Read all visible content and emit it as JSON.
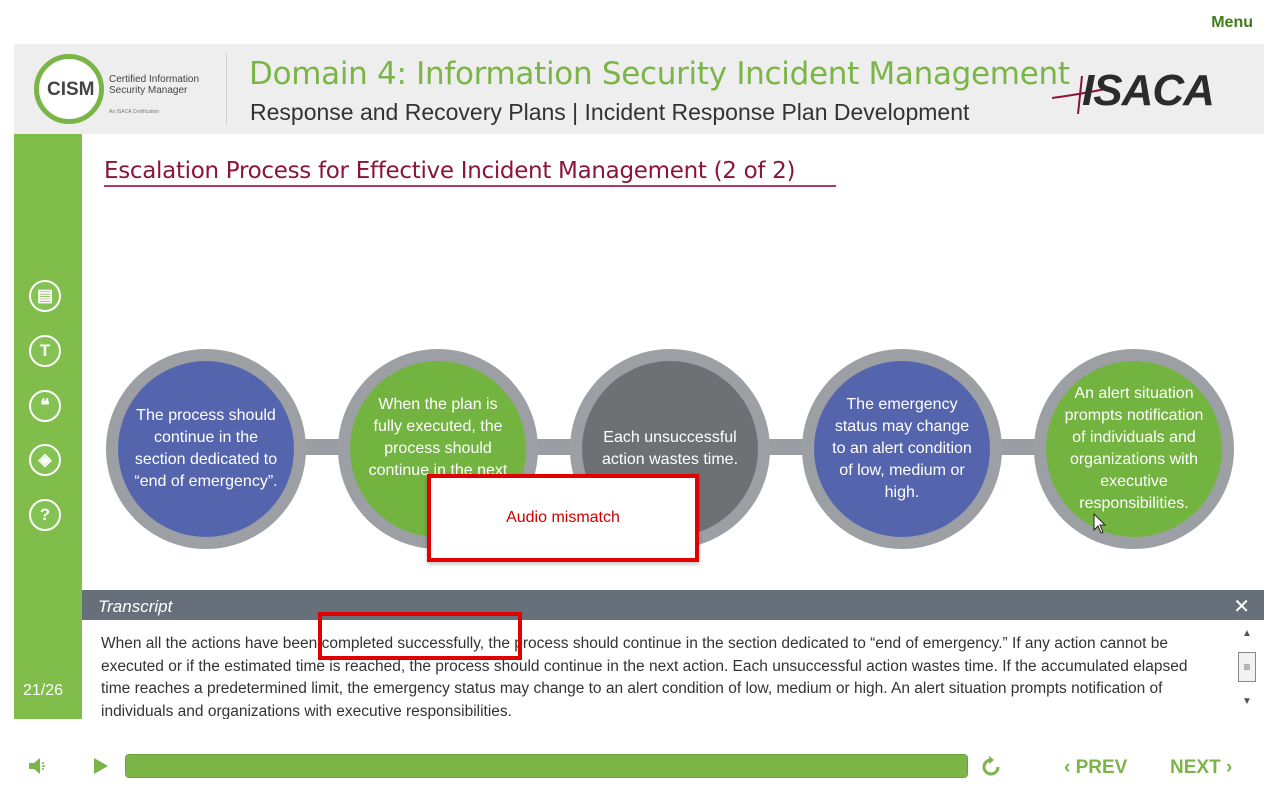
{
  "menu_label": "Menu",
  "header": {
    "logo_text": "CISM",
    "logo_subtitle_line1": "Certified Information",
    "logo_subtitle_line2": "Security Manager",
    "logo_tagline": "An ISACA Certification",
    "domain_title": "Domain 4: Information Security Incident Management",
    "domain_subtitle": "Response and Recovery Plans | Incident Response Plan Development",
    "brand": "ISACA"
  },
  "sidebar": {
    "buttons": [
      {
        "icon": "notes-icon",
        "glyph": "▤"
      },
      {
        "icon": "text-icon",
        "glyph": "T"
      },
      {
        "icon": "quote-icon",
        "glyph": "❝"
      },
      {
        "icon": "layers-icon",
        "glyph": "◈"
      },
      {
        "icon": "help-icon",
        "glyph": "?"
      }
    ],
    "page_counter": "21/26"
  },
  "slide": {
    "title": "Escalation Process for Effective Incident Management (2 of 2)",
    "circles": [
      {
        "text": "The process should continue in the section dedicated to “end of emergency”.",
        "color": "#5565ad"
      },
      {
        "text": "When the plan is fully executed, the process should continue in the next ...",
        "color": "#73b33f"
      },
      {
        "text": "Each unsuccessful action wastes time.",
        "color": "#6d7174"
      },
      {
        "text": "The emergency status may change to an alert condition of low, medium or high.",
        "color": "#5565ad"
      },
      {
        "text": "An alert situation prompts notification of individuals and organizations with executive responsibilities.",
        "color": "#73b33f"
      }
    ]
  },
  "annotation": {
    "label": "Audio mismatch"
  },
  "transcript": {
    "title": "Transcript",
    "close_glyph": "✕",
    "text": "When all the actions have been completed successfully, the process should continue in the section dedicated to “end of emergency.” If any action cannot be executed or if the estimated time is reached, the process should continue in the next action. Each unsuccessful action wastes time. If the accumulated elapsed time reaches a predetermined limit, the emergency status may change to an alert condition of low, medium or high. An alert situation prompts notification of individuals and organizations with executive responsibilities."
  },
  "footer": {
    "progress_fraction": 1.0,
    "prev_label": "PREV",
    "next_label": "NEXT"
  },
  "colors": {
    "accent_green": "#7bb548",
    "title_maroon": "#8a1538",
    "alert_red": "#e00000"
  }
}
